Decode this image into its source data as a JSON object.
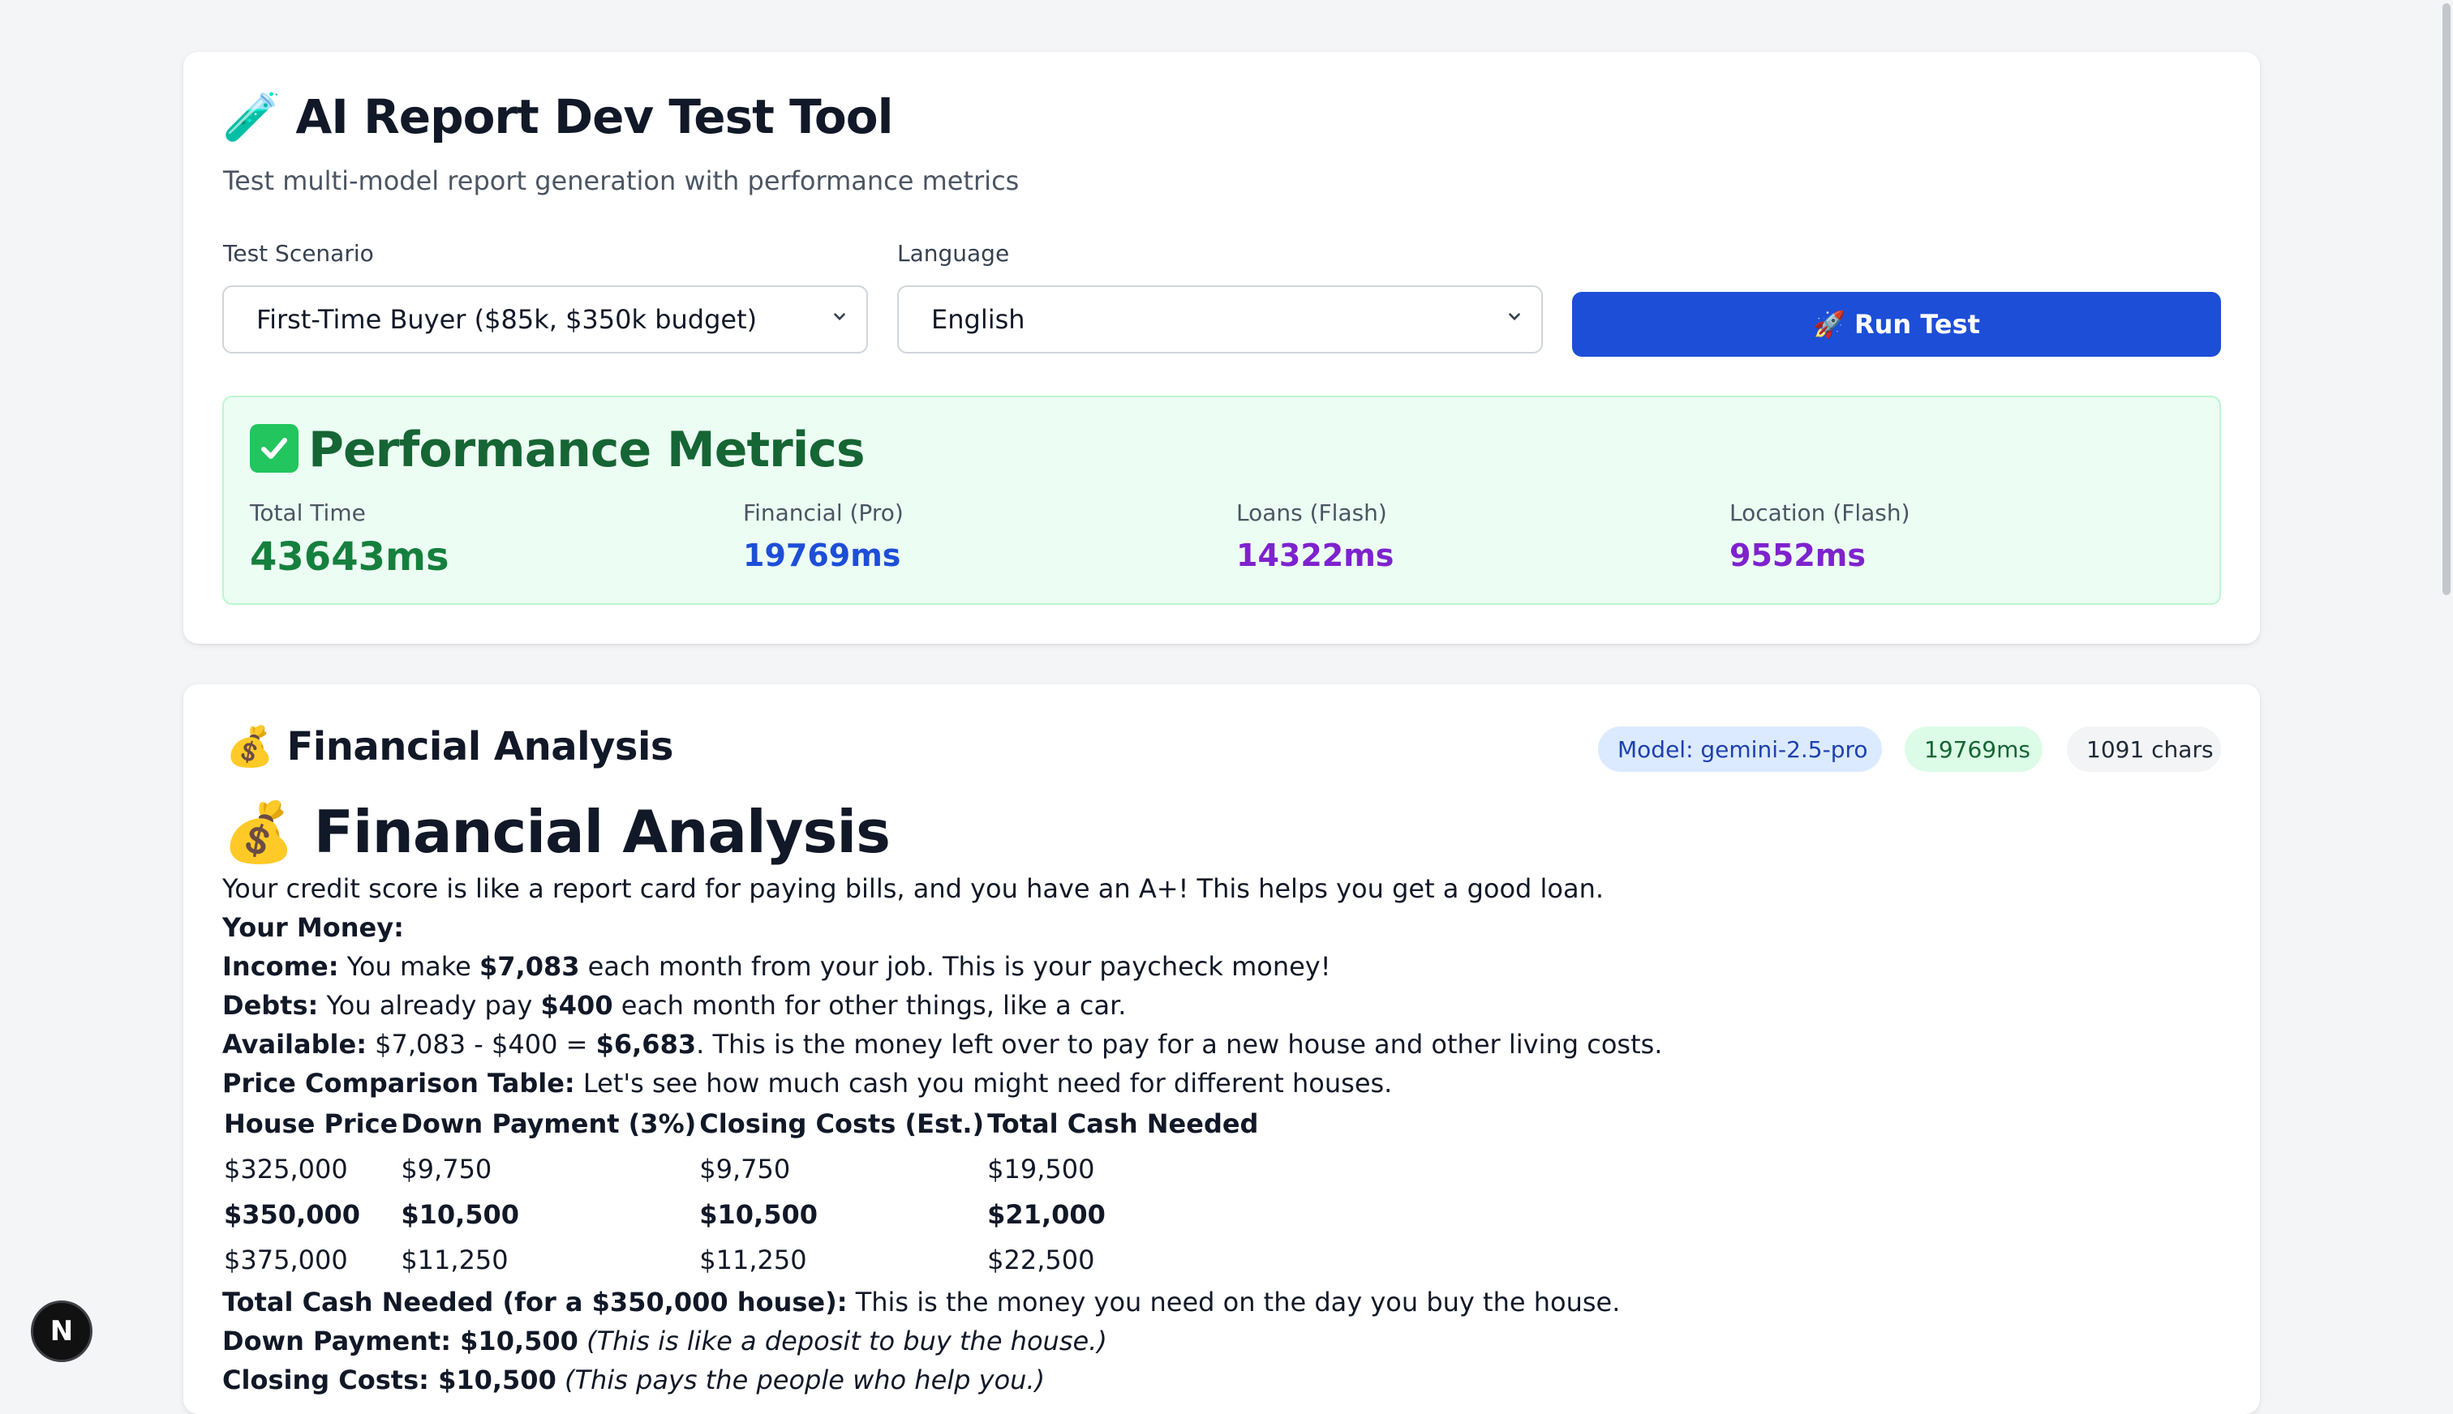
{
  "header": {
    "icon": "test-tube-icon",
    "title": "🧪 AI Report Dev Test Tool",
    "subtitle": "Test multi-model report generation with performance metrics"
  },
  "controls": {
    "scenario_label": "Test Scenario",
    "scenario_value": "First-Time Buyer ($85k, $350k budget)",
    "language_label": "Language",
    "language_value": "English",
    "run_button": "🚀 Run Test"
  },
  "metrics": {
    "title": "Performance Metrics",
    "items": [
      {
        "label": "Total Time",
        "value": "43643ms",
        "color": "#15803d"
      },
      {
        "label": "Financial (Pro)",
        "value": "19769ms",
        "color": "#1d4ed8"
      },
      {
        "label": "Loans (Flash)",
        "value": "14322ms",
        "color": "#7e22ce"
      },
      {
        "label": "Location (Flash)",
        "value": "9552ms",
        "color": "#7e22ce"
      }
    ]
  },
  "report": {
    "section_title": "💰 Financial Analysis",
    "badges": {
      "model": "Model: gemini-2.5-pro",
      "time": "19769ms",
      "chars": "1091 chars"
    },
    "heading": "💰 Financial Analysis",
    "intro": "Your credit score is like a report card for paying bills, and you have an A+! This helps you get a good loan.",
    "your_money": "Your Money:",
    "income_label": "Income:",
    "income_pre": "You make",
    "income_value": "$7,083",
    "income_post": "each month from your job. This is your paycheck money!",
    "debts_label": "Debts:",
    "debts_pre": "You already pay",
    "debts_value": "$400",
    "debts_post": "each month for other things, like a car.",
    "available_label": "Available:",
    "available_pre": "$7,083 - $400 =",
    "available_value": "$6,683",
    "available_post": ". This is the money left over to pay for a new house and other living costs.",
    "table_intro_label": "Price Comparison Table:",
    "table_intro": "Let's see how much cash you might need for different houses.",
    "table_headers": [
      "House Price",
      "Down Payment (3%)",
      "Closing Costs (Est.)",
      "Total Cash Needed"
    ],
    "table_rows": [
      [
        "$325,000",
        "$9,750",
        "$9,750",
        "$19,500"
      ],
      [
        "$350,000",
        "$10,500",
        "$10,500",
        "$21,000"
      ],
      [
        "$375,000",
        "$11,250",
        "$11,250",
        "$22,500"
      ]
    ],
    "total_label": "Total Cash Needed (for a $350,000 house):",
    "total_text": "This is the money you need on the day you buy the house.",
    "down_label": "Down Payment: $10,500",
    "down_note": "(This is like a deposit to buy the house.)",
    "closing_label": "Closing Costs: $10,500",
    "closing_note": "(This pays the people who help you.)"
  },
  "next_badge": "N"
}
